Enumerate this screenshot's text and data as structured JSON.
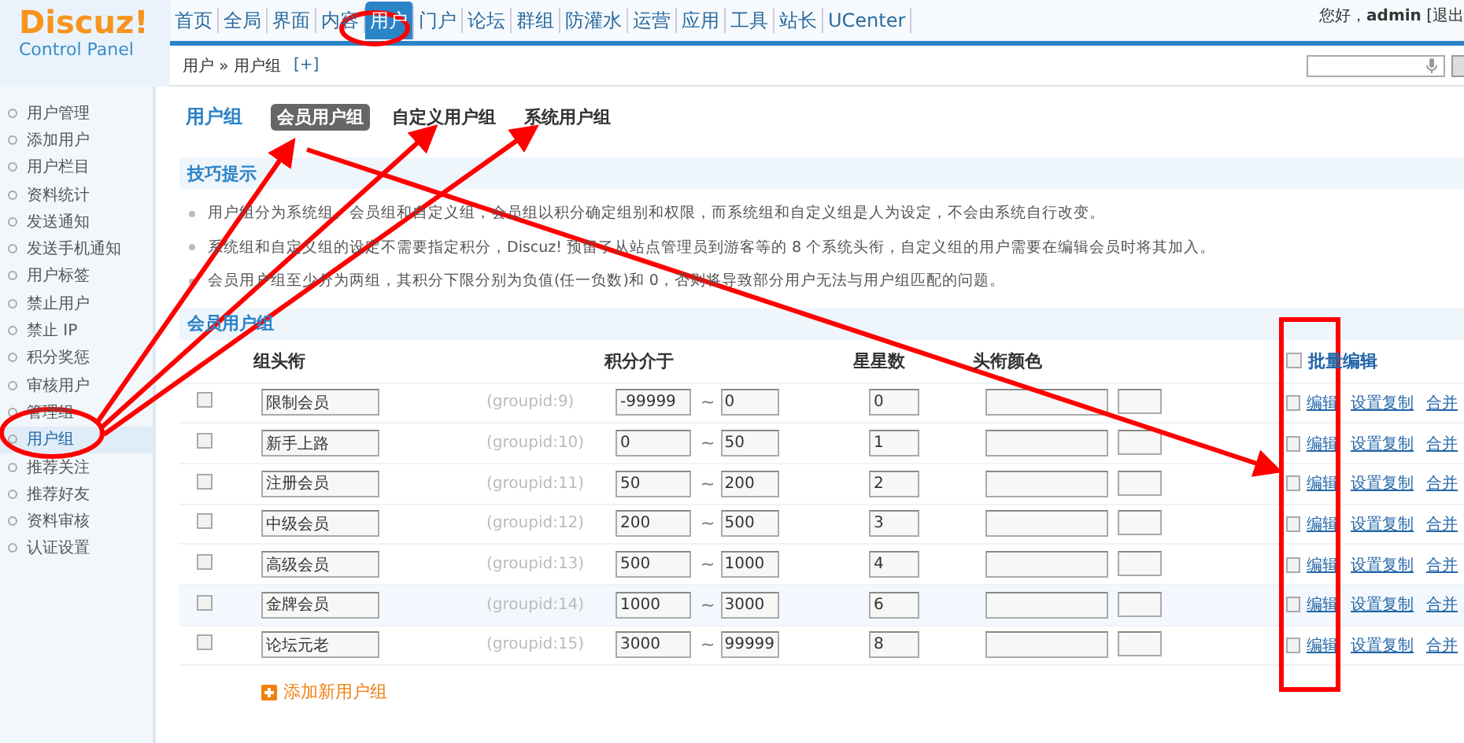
{
  "logo": {
    "title": "Discuz!",
    "subtitle": "Control Panel"
  },
  "nav": [
    {
      "label": "首页",
      "selected": false
    },
    {
      "label": "全局",
      "selected": false
    },
    {
      "label": "界面",
      "selected": false
    },
    {
      "label": "内容",
      "selected": false
    },
    {
      "label": "用户",
      "selected": true
    },
    {
      "label": "门户",
      "selected": false
    },
    {
      "label": "论坛",
      "selected": false
    },
    {
      "label": "群组",
      "selected": false
    },
    {
      "label": "防灌水",
      "selected": false
    },
    {
      "label": "运营",
      "selected": false
    },
    {
      "label": "应用",
      "selected": false
    },
    {
      "label": "工具",
      "selected": false
    },
    {
      "label": "站长",
      "selected": false
    },
    {
      "label": "UCenter",
      "selected": false
    }
  ],
  "user_bar": "您好，**admin** [退出",
  "breadcrumb": {
    "path": "用户 » 用户组",
    "add": "[+]"
  },
  "sidebar": {
    "items": [
      {
        "label": "用户管理",
        "selected": false
      },
      {
        "label": "添加用户",
        "selected": false
      },
      {
        "label": "用户栏目",
        "selected": false
      },
      {
        "label": "资料统计",
        "selected": false
      },
      {
        "label": "发送通知",
        "selected": false
      },
      {
        "label": "发送手机通知",
        "selected": false
      },
      {
        "label": "用户标签",
        "selected": false
      },
      {
        "label": "禁止用户",
        "selected": false
      },
      {
        "label": "禁止 IP",
        "selected": false
      },
      {
        "label": "积分奖惩",
        "selected": false
      },
      {
        "label": "审核用户",
        "selected": false
      },
      {
        "label": "管理组",
        "selected": false
      },
      {
        "label": "用户组",
        "selected": true
      },
      {
        "label": "推荐关注",
        "selected": false
      },
      {
        "label": "推荐好友",
        "selected": false
      },
      {
        "label": "资料审核",
        "selected": false
      },
      {
        "label": "认证设置",
        "selected": false
      }
    ]
  },
  "page_title": "用户组",
  "tabs": [
    {
      "label": "会员用户组",
      "selected": true
    },
    {
      "label": "自定义用户组",
      "selected": false
    },
    {
      "label": "系统用户组",
      "selected": false
    }
  ],
  "tips": {
    "title": "技巧提示",
    "items": [
      "用户组分为系统组、会员组和自定义组，会员组以积分确定组别和权限，而系统组和自定义组是人为设定，不会由系统自行改变。",
      "系统组和自定义组的设定不需要指定积分，Discuz! 预留了从站点管理员到游客等的 8 个系统头衔，自定义组的用户需要在编辑会员时将其加入。",
      "会员用户组至少分为两组，其积分下限分别为负值(任一负数)和 0，否则将导致部分用户无法与用户组匹配的问题。"
    ]
  },
  "section_title": "会员用户组",
  "table": {
    "columns": [
      "组头衔",
      "积分介于",
      "星星数",
      "头衔颜色"
    ],
    "batch_label": "批量编辑",
    "batch_checked": false,
    "rows": [
      {
        "checked": false,
        "highlighted": false,
        "name": "限制会员",
        "groupid": "(groupid:9)",
        "min": "-99999",
        "range_separator": "~",
        "max": "0",
        "star_count": "0",
        "batch_checked": false,
        "actions": [
          "编辑",
          "设置复制",
          "合并"
        ]
      },
      {
        "checked": false,
        "highlighted": false,
        "name": "新手上路",
        "groupid": "(groupid:10)",
        "min": "0",
        "range_separator": "~",
        "max": "50",
        "star_count": "1",
        "batch_checked": false,
        "actions": [
          "编辑",
          "设置复制",
          "合并"
        ]
      },
      {
        "checked": false,
        "highlighted": false,
        "name": "注册会员",
        "groupid": "(groupid:11)",
        "min": "50",
        "range_separator": "~",
        "max": "200",
        "star_count": "2",
        "batch_checked": false,
        "actions": [
          "编辑",
          "设置复制",
          "合并"
        ]
      },
      {
        "checked": false,
        "highlighted": false,
        "name": "中级会员",
        "groupid": "(groupid:12)",
        "min": "200",
        "range_separator": "~",
        "max": "500",
        "star_count": "3",
        "batch_checked": false,
        "actions": [
          "编辑",
          "设置复制",
          "合并"
        ]
      },
      {
        "checked": false,
        "highlighted": false,
        "name": "高级会员",
        "groupid": "(groupid:13)",
        "min": "500",
        "range_separator": "~",
        "max": "1000",
        "star_count": "4",
        "batch_checked": false,
        "actions": [
          "编辑",
          "设置复制",
          "合并"
        ]
      },
      {
        "checked": false,
        "highlighted": true,
        "name": "金牌会员",
        "groupid": "(groupid:14)",
        "min": "1000",
        "range_separator": "~",
        "max": "3000",
        "star_count": "6",
        "batch_checked": false,
        "actions": [
          "编辑",
          "设置复制",
          "合并"
        ]
      },
      {
        "checked": false,
        "highlighted": false,
        "name": "论坛元老",
        "groupid": "(groupid:15)",
        "min": "3000",
        "range_separator": "~",
        "max": "99999",
        "star_count": "8",
        "batch_checked": false,
        "actions": [
          "编辑",
          "设置复制",
          "合并"
        ]
      }
    ]
  },
  "add_link": "添加新用户组"
}
